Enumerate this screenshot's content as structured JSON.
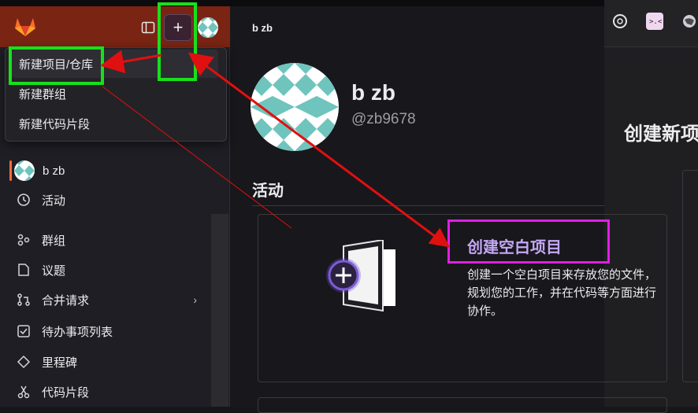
{
  "header": {
    "sidebar_toggle_icon": "sidebar-toggle-icon",
    "new_icon": "plus-icon",
    "new_symbol": "+"
  },
  "dropdown": {
    "items": [
      {
        "label": "新建项目/仓库"
      },
      {
        "label": "新建群组"
      },
      {
        "label": "新建代码片段"
      }
    ]
  },
  "sidebar": {
    "user_label": "b zb",
    "items": [
      {
        "label": "活动",
        "icon": "history-icon"
      },
      {
        "label": "群组",
        "icon": "group-icon"
      },
      {
        "label": "议题",
        "icon": "issues-icon"
      },
      {
        "label": "合并请求",
        "icon": "merge-request-icon",
        "chevron": "›"
      },
      {
        "label": "待办事项列表",
        "icon": "todo-icon"
      },
      {
        "label": "里程碑",
        "icon": "milestone-icon"
      },
      {
        "label": "代码片段",
        "icon": "snippet-icon"
      }
    ]
  },
  "breadcrumb": "b zb",
  "profile": {
    "name": "b zb",
    "handle": "@zb9678"
  },
  "section_title": "活动",
  "card": {
    "title": "创建空白项目",
    "description": "创建一个空白项目来存放您的文件，规划您的工作，并在代码等方面进行协作。"
  },
  "background": {
    "heading": "创建新项"
  },
  "colors": {
    "header_bg": "#7a2414",
    "accent_purple": "#c4a7f5",
    "annotation_green": "#18e01a",
    "annotation_magenta": "#e21ee2",
    "annotation_red": "#e01010"
  }
}
